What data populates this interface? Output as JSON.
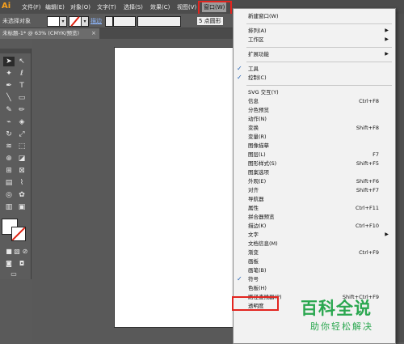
{
  "app": {
    "logo": "Ai"
  },
  "menubar": {
    "items": [
      "文件(F)",
      "编辑(E)",
      "对象(O)",
      "文字(T)",
      "选择(S)",
      "效果(C)",
      "视图(V)",
      "窗口(W)"
    ]
  },
  "control_bar": {
    "no_selection": "未选择对象",
    "stroke_label": "描边",
    "points_label": "5 点圆形"
  },
  "document_tab": {
    "title": "未标题-1* @ 63% (CMYK/预览)",
    "close": "×"
  },
  "window_menu": {
    "items": [
      {
        "label": "新建窗口(W)"
      },
      {
        "separator": true
      },
      {
        "label": "排列(A)",
        "submenu": true
      },
      {
        "label": "工作区",
        "submenu": true
      },
      {
        "separator": true
      },
      {
        "label": "扩展功能",
        "submenu": true
      },
      {
        "separator": true
      },
      {
        "label": "工具",
        "checked": true
      },
      {
        "label": "控制(C)",
        "checked": true
      },
      {
        "separator": true
      },
      {
        "label": "SVG 交互(Y)"
      },
      {
        "label": "信息",
        "shortcut": "Ctrl+F8"
      },
      {
        "label": "分色预览"
      },
      {
        "label": "动作(N)"
      },
      {
        "label": "变换",
        "shortcut": "Shift+F8"
      },
      {
        "label": "变量(R)"
      },
      {
        "label": "图像描摹"
      },
      {
        "label": "图层(L)",
        "shortcut": "F7"
      },
      {
        "label": "图形样式(S)",
        "shortcut": "Shift+F5"
      },
      {
        "label": "图案选项"
      },
      {
        "label": "外观(E)",
        "shortcut": "Shift+F6"
      },
      {
        "label": "对齐",
        "shortcut": "Shift+F7"
      },
      {
        "label": "导航器"
      },
      {
        "label": "属性",
        "shortcut": "Ctrl+F11"
      },
      {
        "label": "拼合器预览"
      },
      {
        "label": "描边(K)",
        "shortcut": "Ctrl+F10"
      },
      {
        "label": "文字",
        "submenu": true
      },
      {
        "label": "文档信息(M)"
      },
      {
        "label": "渐变",
        "shortcut": "Ctrl+F9"
      },
      {
        "label": "画板"
      },
      {
        "label": "画笔(B)"
      },
      {
        "label": "符号",
        "checked": true
      },
      {
        "label": "色板(H)"
      },
      {
        "label": "路径查找器(P)",
        "shortcut": "Shift+Ctrl+F9"
      },
      {
        "label": "透明度"
      }
    ]
  },
  "watermark": {
    "title": "百科全说",
    "subtitle": "助你轻松解决"
  },
  "colors": {
    "accent_red": "#e2251f",
    "watermark_green": "#2aa74f",
    "menu_bg": "#f2f2f2"
  }
}
